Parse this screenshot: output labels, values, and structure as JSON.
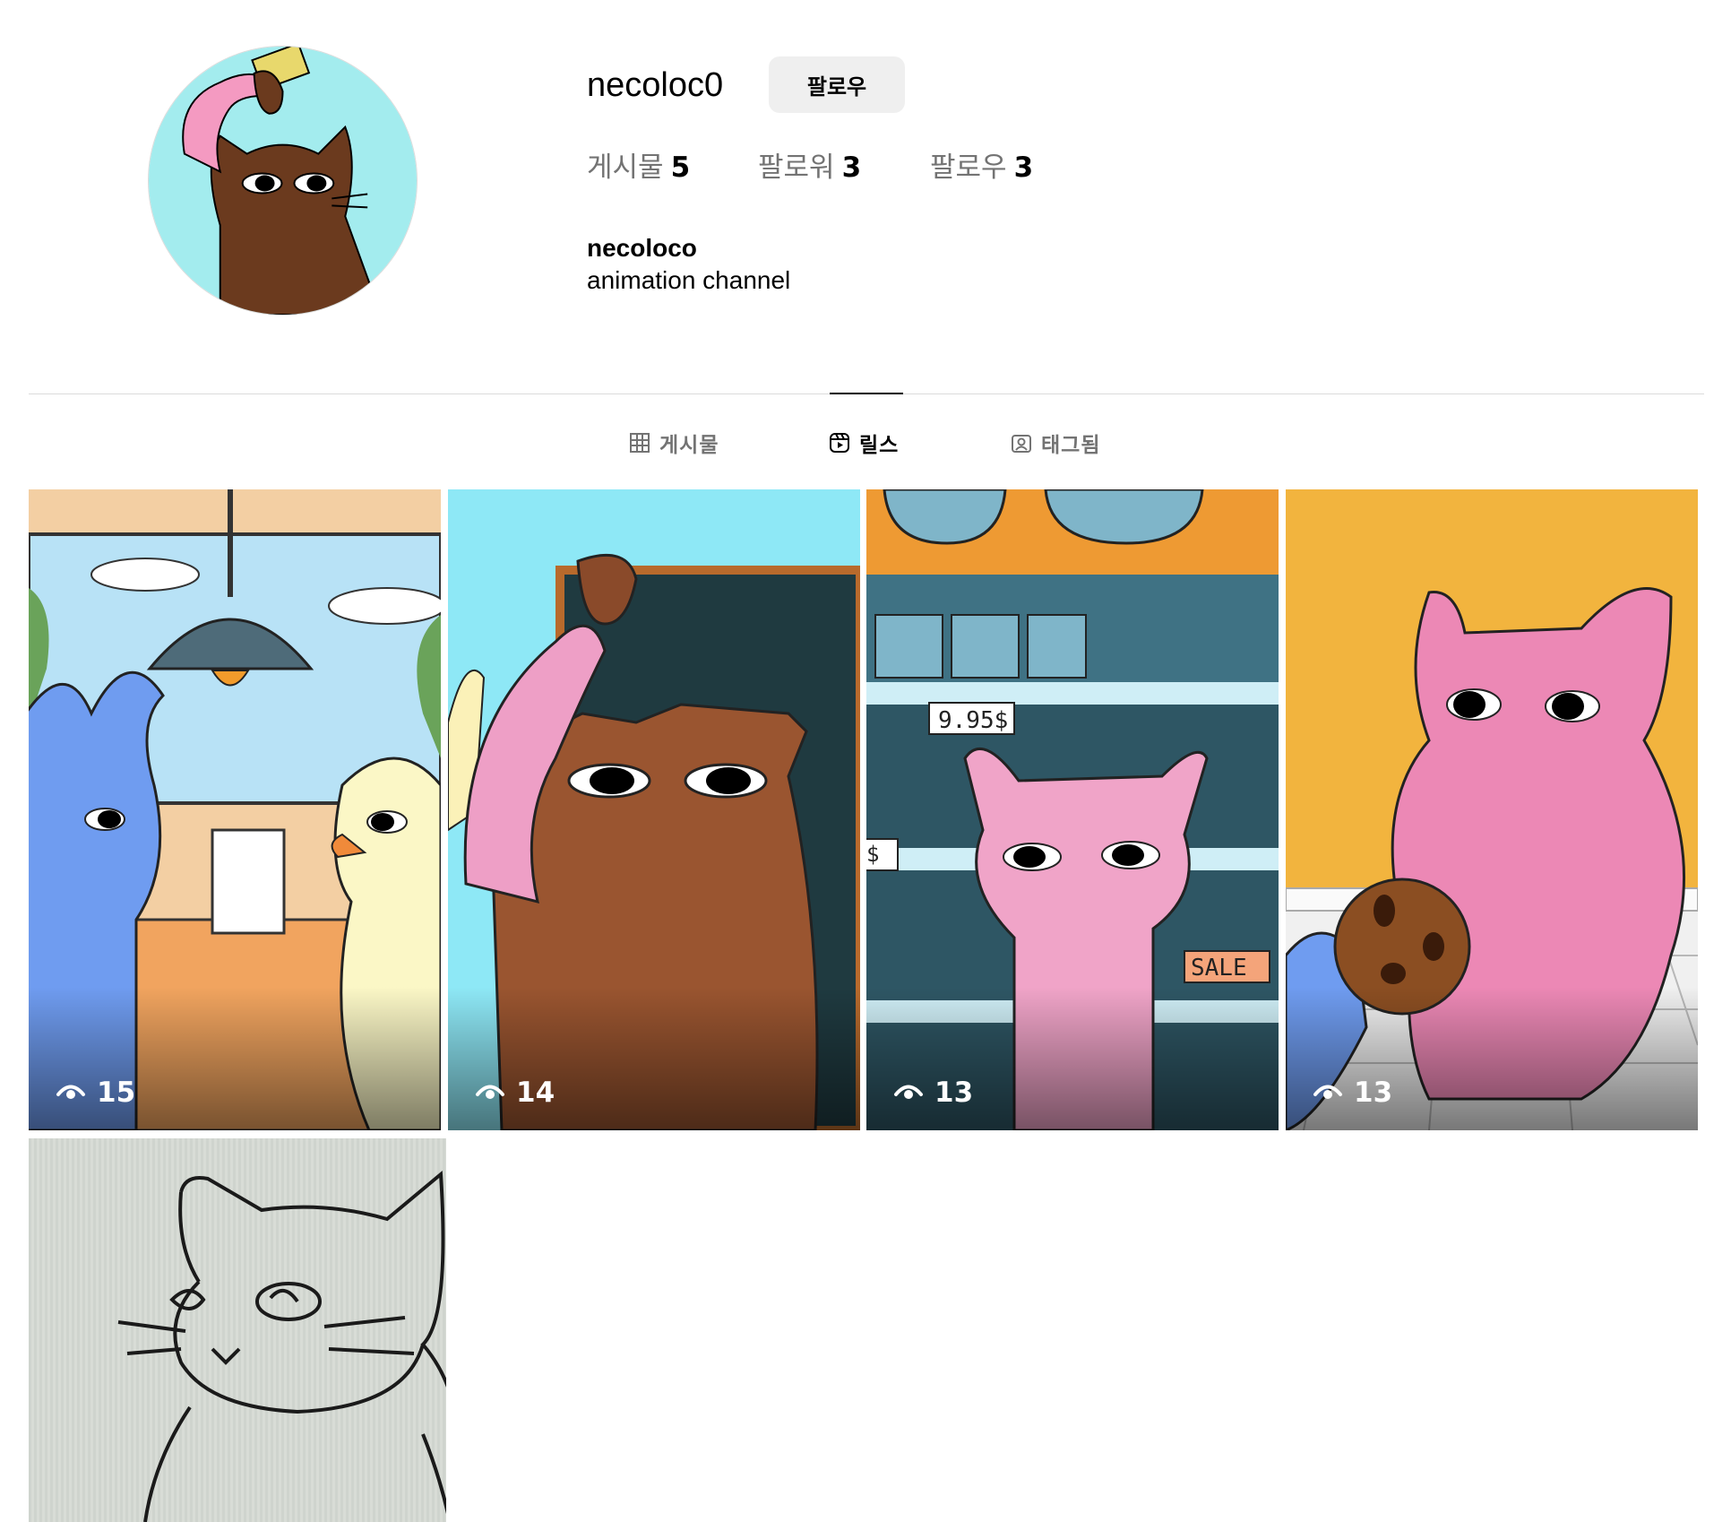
{
  "profile": {
    "username": "necoloc0",
    "follow_label": "팔로우",
    "full_name": "necoloco",
    "bio": "animation channel",
    "avatar_icon": "cat-avatar"
  },
  "stats": {
    "posts_label": "게시물",
    "posts_count": "5",
    "followers_label": "팔로워",
    "followers_count": "3",
    "following_label": "팔로우",
    "following_count": "3"
  },
  "tabs": [
    {
      "label": "게시물",
      "icon": "grid-icon",
      "active": false
    },
    {
      "label": "릴스",
      "icon": "reels-icon",
      "active": true
    },
    {
      "label": "태그됨",
      "icon": "tagged-icon",
      "active": false
    }
  ],
  "reels": [
    {
      "views": "15",
      "thumbnail": "bunny-and-duck-at-table"
    },
    {
      "views": "14",
      "thumbnail": "brown-cat-with-chocolate"
    },
    {
      "views": "13",
      "thumbnail": "pink-cat-in-store",
      "price_tags": [
        "9.95$",
        "$"
      ],
      "sign_text": "SALE"
    },
    {
      "views": "13",
      "thumbnail": "pink-cat-with-cookie"
    }
  ],
  "posts": [
    {
      "thumbnail": "cat-line-drawing"
    }
  ],
  "colors": {
    "tab_muted": "#737373",
    "follow_button_bg": "#efefef",
    "divider": "#dbdbdb",
    "avatar_bg": "#a3ecee"
  }
}
